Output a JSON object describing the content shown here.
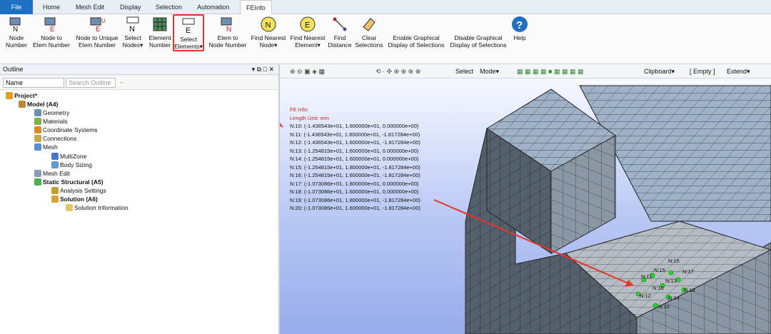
{
  "menu": {
    "file": "File",
    "tabs": [
      "Home",
      "Mesh Edit",
      "Display",
      "Selection",
      "Automation",
      "FEInfo"
    ]
  },
  "ribbon": {
    "node_number": "Node\nNumber",
    "node_to_elem": "Node to\nElem Number",
    "node_to_unique": "Node to Unique\nElem Number",
    "select_nodes": "Select\nNodes▾",
    "element_number": "Element\nNumber",
    "select_elements": "Select\nElements▾",
    "elem_to_node": "Elem to\nNode Number",
    "find_nearest_node": "Find Nearest\nNode▾",
    "find_nearest_element": "Find Nearest\nElement▾",
    "find_distance": "Find\nDistance",
    "clear_selections": "Clear\nSelections",
    "enable_graphical": "Enable Graphical\nDisplay of Selections",
    "disable_graphical": "Disable Graphical\nDisplay of Selections",
    "help": "Help"
  },
  "outline": {
    "title": "Outline",
    "controls": "▾ ⧉ □ ✕",
    "filter_select": "Name",
    "search_placeholder": "Search Outline",
    "tree": {
      "project": "Project*",
      "model": "Model (A4)",
      "geometry": "Geometry",
      "materials": "Materials",
      "coord": "Coordinate Systems",
      "connections": "Connections",
      "mesh": "Mesh",
      "multizone": "MultiZone",
      "body_sizing": "Body Sizing",
      "mesh_edit": "Mesh Edit",
      "static": "Static Structural (A5)",
      "analysis": "Analysis Settings",
      "solution": "Solution (A6)",
      "solution_info": "Solution Information"
    }
  },
  "viewtoolbar": {
    "select": "Select",
    "mode": "Mode▾",
    "clipboard": "Clipboard▾",
    "empty": "[ Empty ]",
    "extend": "Extend▾"
  },
  "feinfo": {
    "title": "FE Info:",
    "unit": "Length Unit: mm",
    "lines": [
      "N:10: (-1.436543e+01, 1.600000e+01, 0.000000e+00)",
      "N:11: (-1.436543e+01, 1.800000e+01, -1.817284e+00)",
      "N:12: (-1.436543e+01, 1.600000e+01, -1.817284e+00)",
      "N:13: (-1.254815e+01, 1.600000e+01, 0.000000e+00)",
      "N:14: (-1.254815e+01, 1.600000e+01, 0.000000e+00)",
      "N:15: (-1.254815e+01, 1.800000e+01, -1.817284e+00)",
      "N:16: (-1.254815e+01, 1.600000e+01, -1.817284e+00)",
      "N:17: (-1.073086e+01, 1.800000e+01, 0.000000e+00)",
      "N:18: (-1.073086e+01, 1.600000e+01, 0.000000e+00)",
      "N:19: (-1.073086e+01, 1.800000e+01, -1.817284e+00)",
      "N:20: (-1.073086e+01, 1.600000e+01, -1.817284e+00)"
    ]
  },
  "node_labels": [
    "N:10",
    "N:11",
    "N:12",
    "N:13",
    "N:14",
    "N:15",
    "N:16",
    "N:17",
    "N:18",
    "N:19"
  ],
  "colors": {
    "accent": "#1f6fc3",
    "highlight": "#e5342a",
    "node": "#22dd22"
  }
}
